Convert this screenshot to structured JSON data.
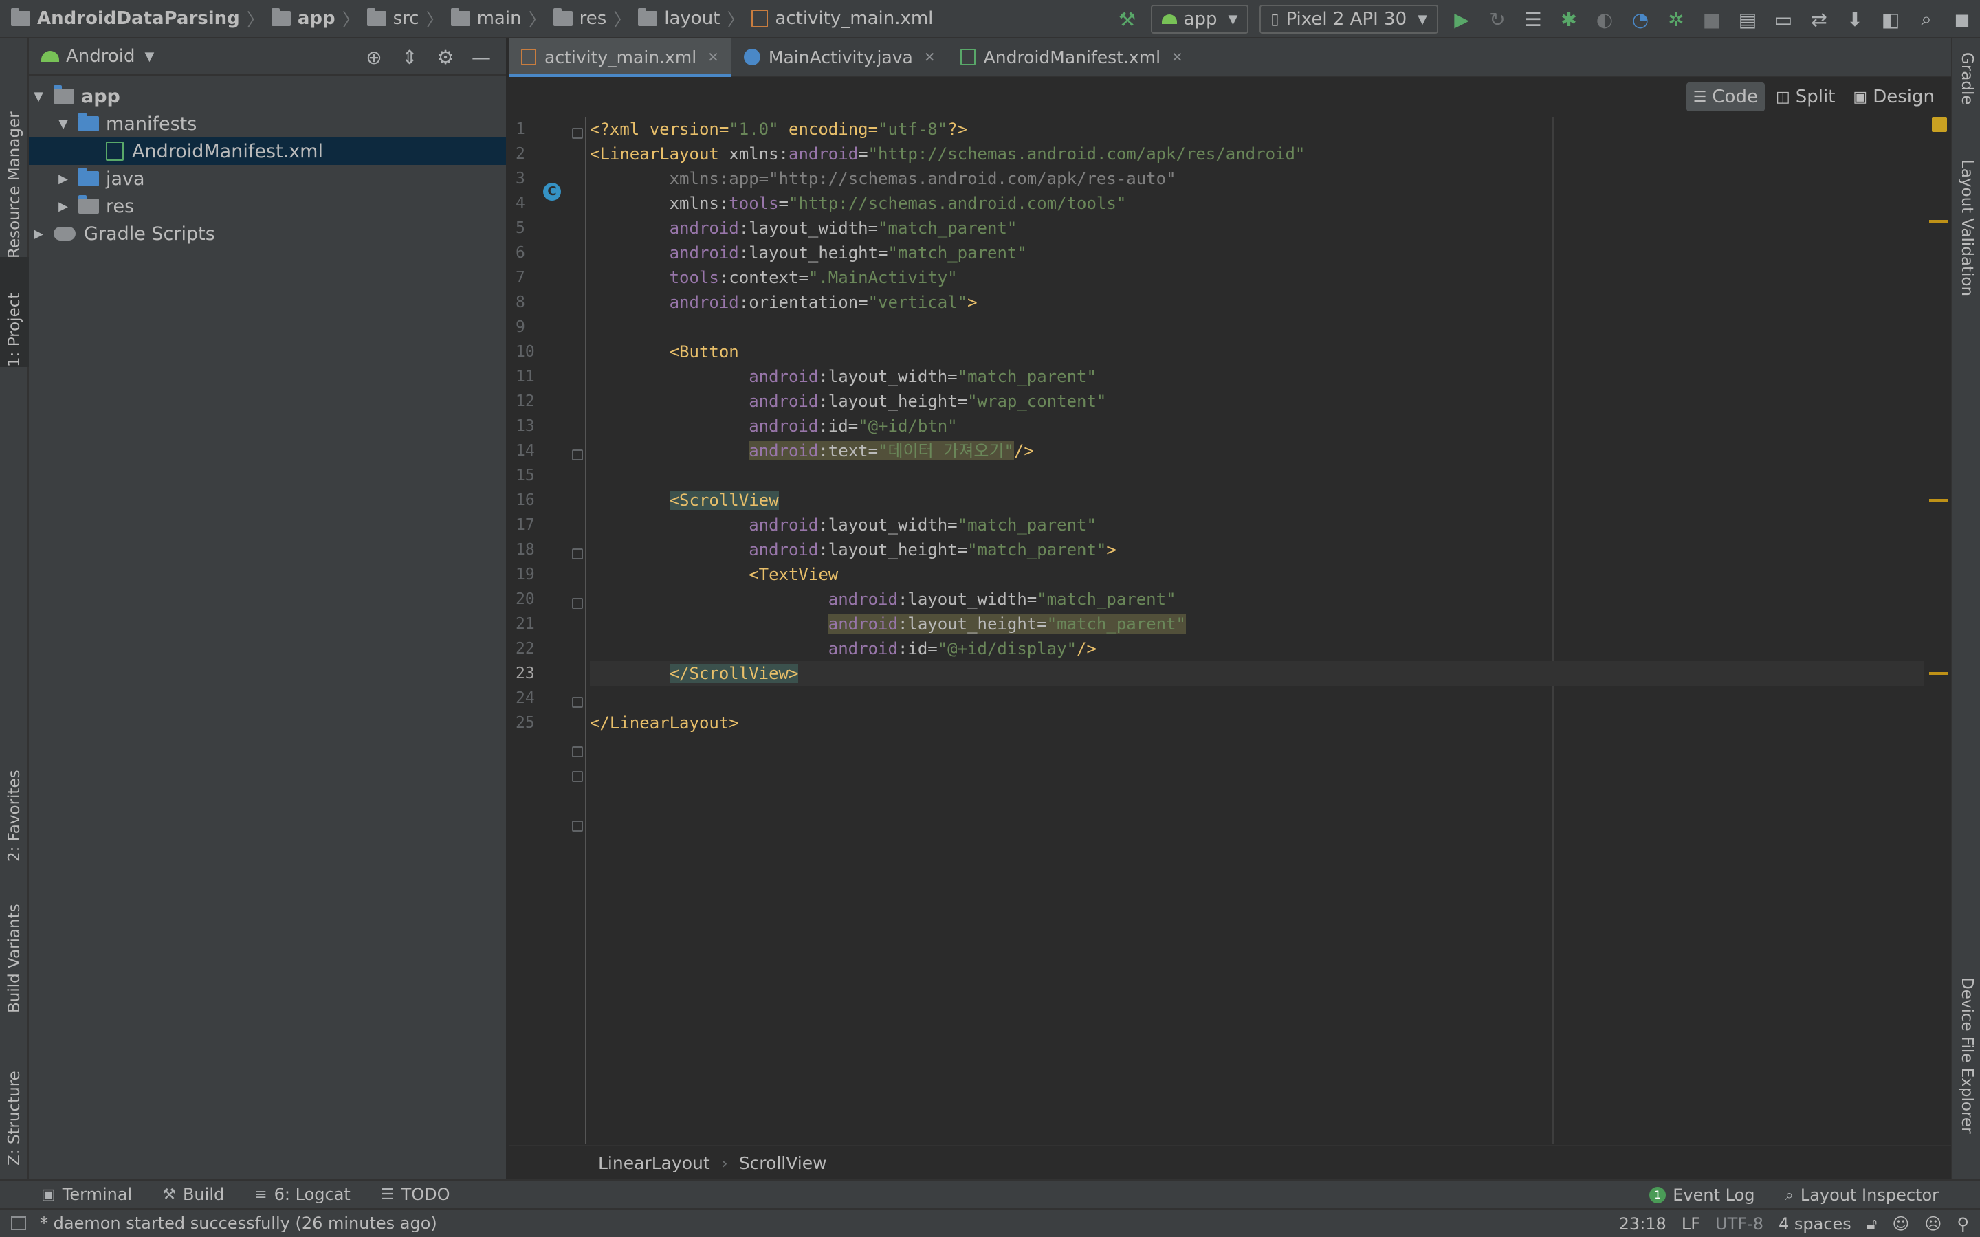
{
  "breadcrumb": [
    {
      "label": "AndroidDataParsing",
      "icon": "project-folder-icon",
      "bold": true
    },
    {
      "label": "app",
      "icon": "module-folder-icon",
      "bold": true
    },
    {
      "label": "src",
      "icon": "folder-icon"
    },
    {
      "label": "main",
      "icon": "folder-icon"
    },
    {
      "label": "res",
      "icon": "res-folder-icon"
    },
    {
      "label": "layout",
      "icon": "folder-icon"
    },
    {
      "label": "activity_main.xml",
      "icon": "xml-file-icon"
    }
  ],
  "toolbar": {
    "run_config": "app",
    "device": "Pixel 2 API 30"
  },
  "left_tool_tabs": {
    "resource_manager": "Resource Manager",
    "project": "1: Project",
    "favorites": "2: Favorites",
    "build_variants": "Build Variants",
    "structure": "Z: Structure"
  },
  "right_tool_tabs": {
    "gradle": "Gradle",
    "layout_validation": "Layout Validation",
    "device_file_explorer": "Device File Explorer"
  },
  "project_panel": {
    "view_mode": "Android",
    "tree": {
      "app": "app",
      "manifests": "manifests",
      "manifest_file": "AndroidManifest.xml",
      "java": "java",
      "res": "res",
      "gradle_scripts": "Gradle Scripts"
    }
  },
  "editor": {
    "tabs": [
      {
        "label": "activity_main.xml",
        "active": true
      },
      {
        "label": "MainActivity.java",
        "active": false
      },
      {
        "label": "AndroidManifest.xml",
        "active": false
      }
    ],
    "view_modes": {
      "code": "Code",
      "split": "Split",
      "design": "Design"
    },
    "line_numbers": [
      "1",
      "2",
      "3",
      "4",
      "5",
      "6",
      "7",
      "8",
      "9",
      "10",
      "11",
      "12",
      "13",
      "14",
      "15",
      "16",
      "17",
      "18",
      "19",
      "20",
      "21",
      "22",
      "23",
      "24",
      "25"
    ],
    "current_line": "23",
    "code": {
      "l1_pre": "<?xml version=",
      "l1_v1": "\"1.0\"",
      "l1_mid": " encoding=",
      "l1_v2": "\"utf-8\"",
      "l1_end": "?>",
      "ll_tag": "<LinearLayout",
      "xmlns_android": " xmlns:",
      "android_ns": "android",
      "eq": "=",
      "android_url": "\"http://schemas.android.com/apk/res/android\"",
      "xmlns_app": "xmlns:app=",
      "app_url": "\"http://schemas.android.com/apk/res-auto\"",
      "xmlns_tools": "xmlns:",
      "tools_ns": "tools",
      "tools_url": "\"http://schemas.android.com/tools\"",
      "lw": ":layout_width=",
      "lh": ":layout_height=",
      "match_parent": "\"match_parent\"",
      "wrap_content": "\"wrap_content\"",
      "ctx": ":context=",
      "ctx_val": "\".MainActivity\"",
      "orient": ":orientation=",
      "orient_val": "\"vertical\"",
      "gt": ">",
      "btn_tag": "<Button",
      "id_attr": ":id=",
      "btn_id": "\"@+id/btn\"",
      "text_attr": ":text=",
      "btn_text": "\"데이터 가져오기\"",
      "self_close": "/>",
      "scroll_tag": "<ScrollView",
      "tv_tag": "<TextView",
      "tv_id": "\"@+id/display\"",
      "scroll_close": "</ScrollView>",
      "ll_close": "</LinearLayout>"
    },
    "breadcrumb": [
      "LinearLayout",
      "ScrollView"
    ]
  },
  "bottom_tools": {
    "terminal": "Terminal",
    "build": "Build",
    "logcat": "6: Logcat",
    "todo": "TODO",
    "event_log": "Event Log",
    "event_count": "1",
    "layout_inspector": "Layout Inspector"
  },
  "status_bar": {
    "message": "* daemon started successfully (26 minutes ago)",
    "position": "23:18",
    "line_sep": "LF",
    "encoding": "UTF-8",
    "indent": "4 spaces"
  }
}
